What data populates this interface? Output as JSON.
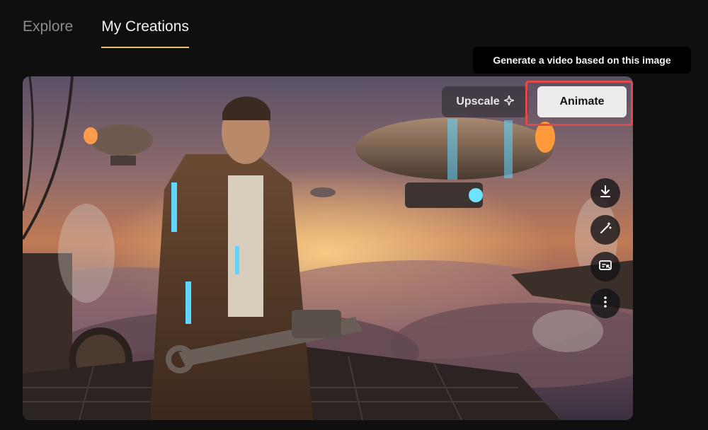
{
  "tabs": [
    {
      "label": "Explore",
      "active": false
    },
    {
      "label": "My Creations",
      "active": true
    }
  ],
  "tooltip": {
    "text": "Generate a video based on this image"
  },
  "actions": {
    "upscale_label": "Upscale",
    "animate_label": "Animate"
  },
  "side_actions": [
    {
      "icon": "download-icon"
    },
    {
      "icon": "magic-wand-icon"
    },
    {
      "icon": "image-edit-icon"
    },
    {
      "icon": "more-vertical-icon"
    }
  ],
  "colors": {
    "tab_underline": "#e9c46a",
    "highlight_border": "#e04a4a",
    "animate_bg": "#ececec"
  }
}
